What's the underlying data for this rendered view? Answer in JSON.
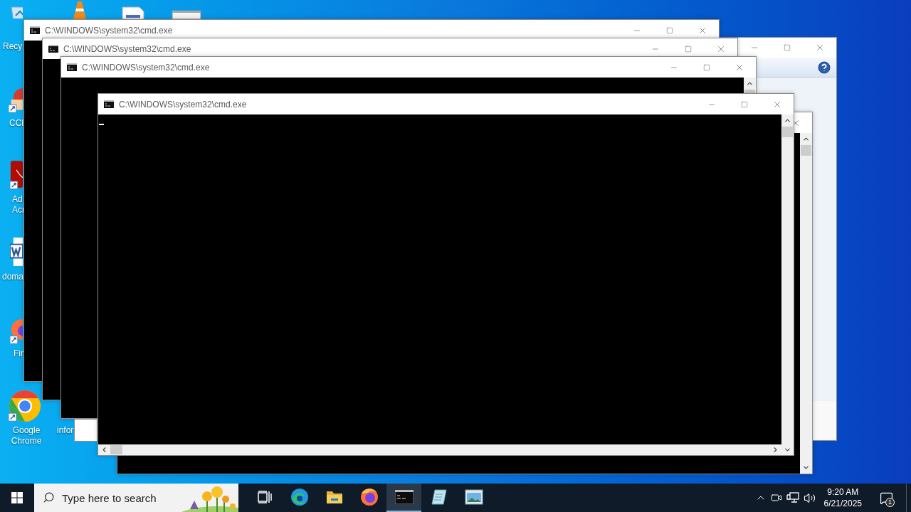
{
  "desktop_icons": [
    {
      "kind": "recycle-bin",
      "label_lines": [
        "Recy"
      ]
    },
    {
      "kind": "cone"
    },
    {
      "kind": "document"
    },
    {
      "kind": "app-window"
    },
    {
      "kind": "brush",
      "label_lines": [
        "CCl"
      ]
    },
    {
      "kind": "pdf",
      "label_lines": [
        "Ad",
        "Acr"
      ]
    },
    {
      "kind": "word",
      "label_lines": [
        "doma"
      ]
    },
    {
      "kind": "fox",
      "label_lines": [
        "Fir"
      ]
    },
    {
      "kind": "chrome",
      "label_lines": [
        "Google",
        "Chrome"
      ]
    },
    {
      "kind": "hidden",
      "label_lines": [
        "infor"
      ]
    }
  ],
  "windows": [
    {
      "kind": "dialog"
    },
    {
      "kind": "console",
      "title": "C:\\WINDOWS\\system32\\cmd.exe"
    },
    {
      "kind": "console",
      "title": "C:\\WINDOWS\\system32\\cmd.exe"
    },
    {
      "kind": "console",
      "title": "C:\\WINDOWS\\system32\\cmd.exe"
    },
    {
      "kind": "blank"
    },
    {
      "kind": "console"
    },
    {
      "kind": "focused-console",
      "title": "C:\\WINDOWS\\system32\\cmd.exe"
    }
  ],
  "taskbar": {
    "search": {
      "placeholder": "Type here to search"
    },
    "apps": [
      {
        "kind": "task-view",
        "selected": false
      },
      {
        "kind": "edge",
        "selected": false
      },
      {
        "kind": "folder",
        "selected": false
      },
      {
        "kind": "fox",
        "selected": false
      },
      {
        "kind": "console",
        "selected": true
      },
      {
        "kind": "notepad",
        "selected": false
      },
      {
        "kind": "picture-viewer",
        "selected": false
      }
    ],
    "clock": {
      "time": "9:20 AM",
      "date": "6/21/2025"
    },
    "notifications": {
      "badge": "1"
    }
  }
}
